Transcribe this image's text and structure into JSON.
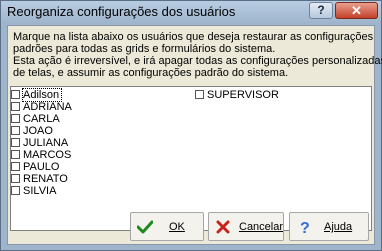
{
  "window": {
    "title": "Reorganiza configurações dos usuários",
    "help_glyph": "?",
    "close_glyph": "✕"
  },
  "info": {
    "line1": "Marque na lista abaixo os usuários que deseja restaurar as configurações",
    "line2": "padrões para todas as grids e formulários do sistema.",
    "line3": "Esta ação é irreversível, e irá apagar todas as configurações personalizadas",
    "line4": "de telas, e assumir as configurações padrão do sistema."
  },
  "users": {
    "col1": [
      "Adilson",
      "ADRIANA",
      "CARLA",
      "JOAO",
      "JULIANA",
      "MARCOS",
      "PAULO",
      "RENATO",
      "SILVIA"
    ],
    "col2": [
      "SUPERVISOR"
    ],
    "checked": []
  },
  "buttons": {
    "ok_label": "OK",
    "cancel_label": "Cancelar",
    "help_label": "Ajuda",
    "ok_icon": "checkmark-icon",
    "cancel_icon": "x-icon",
    "help_icon": "question-icon"
  },
  "colors": {
    "ok_icon": "#1e8a1e",
    "cancel_icon": "#c8231b",
    "help_icon": "#2f6fd6"
  }
}
